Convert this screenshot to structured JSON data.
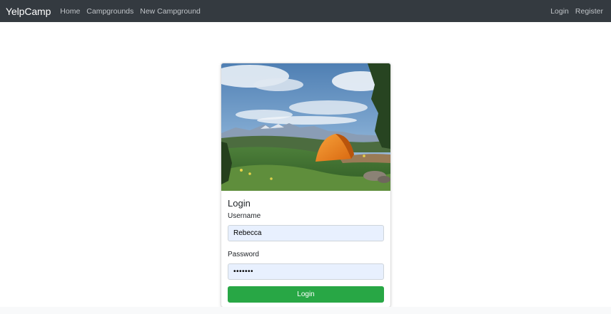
{
  "navbar": {
    "brand": "YelpCamp",
    "links": [
      "Home",
      "Campgrounds",
      "New Campground"
    ],
    "right_links": [
      "Login",
      "Register"
    ]
  },
  "card": {
    "image_alt": "Orange tent on a grassy hillside with mountains",
    "title": "Login",
    "username_label": "Username",
    "username_value": "Rebecca",
    "password_label": "Password",
    "password_value": "•••••••",
    "submit_label": "Login"
  },
  "colors": {
    "navbar_bg": "#343a40",
    "button_bg": "#28a745",
    "input_autofill_bg": "#e8f0fe"
  }
}
